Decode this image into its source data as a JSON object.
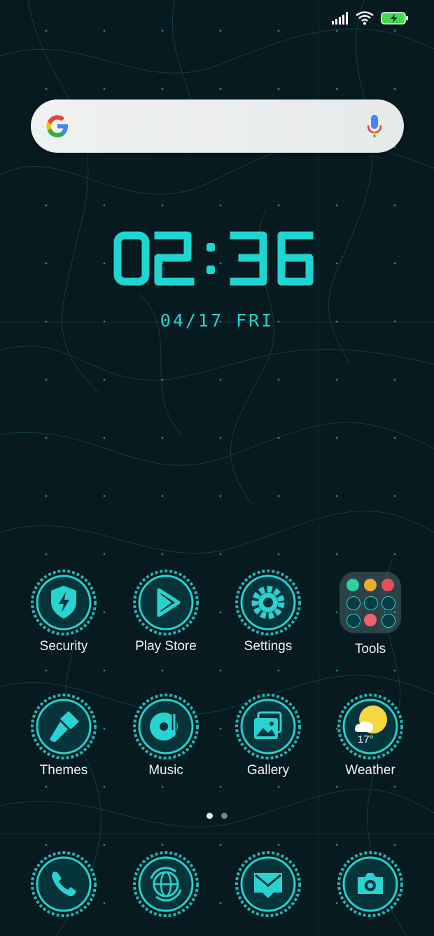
{
  "status": {
    "icons": [
      "signal-icon",
      "wifi-icon",
      "battery-charging-icon"
    ]
  },
  "search": {
    "icons": [
      "google-logo-icon",
      "microphone-icon"
    ]
  },
  "clock": {
    "time": "02:36",
    "date": "04/17 FRI"
  },
  "apps_row1": [
    {
      "label": "Security",
      "icon": "shield-bolt-icon"
    },
    {
      "label": "Play Store",
      "icon": "play-icon"
    },
    {
      "label": "Settings",
      "icon": "gear-icon"
    },
    {
      "label": "Tools",
      "icon": "folder-icon"
    }
  ],
  "apps_row2": [
    {
      "label": "Themes",
      "icon": "brush-icon"
    },
    {
      "label": "Music",
      "icon": "music-disc-icon"
    },
    {
      "label": "Gallery",
      "icon": "gallery-icon"
    },
    {
      "label": "Weather",
      "icon": "weather-icon",
      "temp": "17°"
    }
  ],
  "dock": [
    {
      "icon": "phone-icon"
    },
    {
      "icon": "browser-icon"
    },
    {
      "icon": "messages-icon"
    },
    {
      "icon": "camera-icon"
    }
  ],
  "pager": {
    "pages": 2,
    "current": 1
  },
  "colors": {
    "accent": "#1fd5d1",
    "background": "#061a1f"
  }
}
